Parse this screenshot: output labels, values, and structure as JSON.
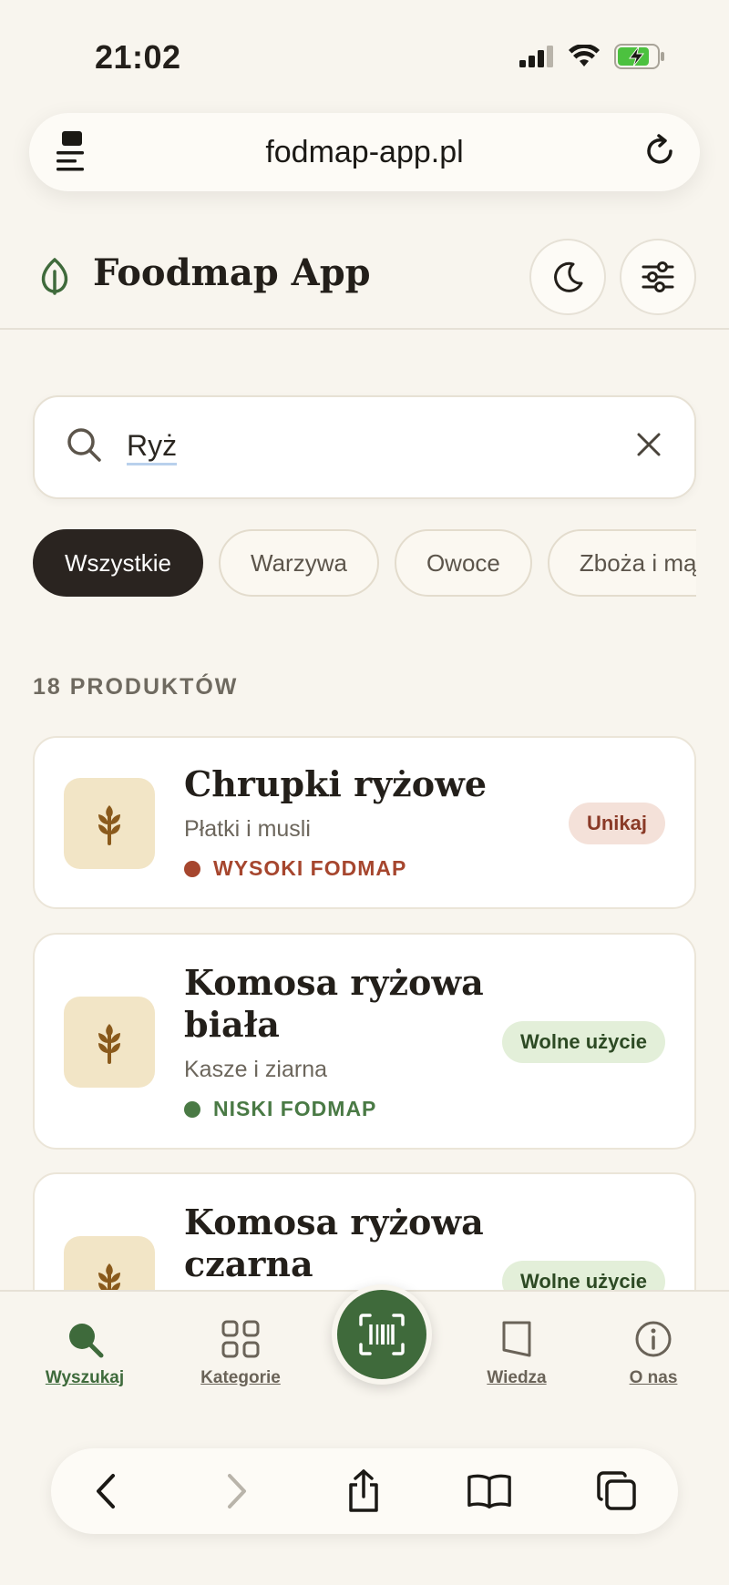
{
  "status_bar": {
    "time": "21:02"
  },
  "browser": {
    "url": "fodmap-app.pl"
  },
  "app": {
    "title": "Foodmap App"
  },
  "search": {
    "value": "Ryż",
    "placeholder": ""
  },
  "filters": {
    "chips": [
      "Wszystkie",
      "Warzywa",
      "Owoce",
      "Zboża i mąka"
    ],
    "active": "Wszystkie"
  },
  "results": {
    "count_label": "18 PRODUKTÓW",
    "items": [
      {
        "name": "Chrupki ryżowe",
        "category": "Płatki i musli",
        "fodmap_level": "WYSOKI FODMAP",
        "badge": "Unikaj"
      },
      {
        "name": "Komosa ryżowa biała",
        "category": "Kasze i ziarna",
        "fodmap_level": "NISKI FODMAP",
        "badge": "Wolne użycie"
      },
      {
        "name": "Komosa ryżowa czarna",
        "category": "",
        "fodmap_level": "",
        "badge": "Wolne użycie"
      }
    ]
  },
  "bottom_nav": {
    "items": [
      "Wyszukaj",
      "Kategorie",
      "Wiedza",
      "O nas"
    ],
    "active": "Wyszukaj"
  },
  "icons": {
    "status": [
      "signal-icon",
      "wifi-icon",
      "battery-charging-icon"
    ],
    "url_bar": [
      "page-menu-icon",
      "reload-icon"
    ],
    "header": [
      "leaf-icon",
      "moon-icon",
      "sliders-icon"
    ],
    "search": [
      "search-icon",
      "clear-icon"
    ],
    "card": "wheat-icon",
    "nav": [
      "search-icon",
      "grid-icon",
      "barcode-scan-icon",
      "book-icon",
      "info-icon"
    ],
    "safari": [
      "back-icon",
      "forward-icon",
      "share-icon",
      "bookmarks-icon",
      "tabs-icon"
    ]
  },
  "colors": {
    "background": "#f8f5ee",
    "accent_green": "#3f6a3b",
    "high_fodmap": "#a6462e",
    "low_fodmap": "#4a7a45",
    "chip_active": "#2a2420",
    "thumb_bg": "#f2e5c6"
  }
}
